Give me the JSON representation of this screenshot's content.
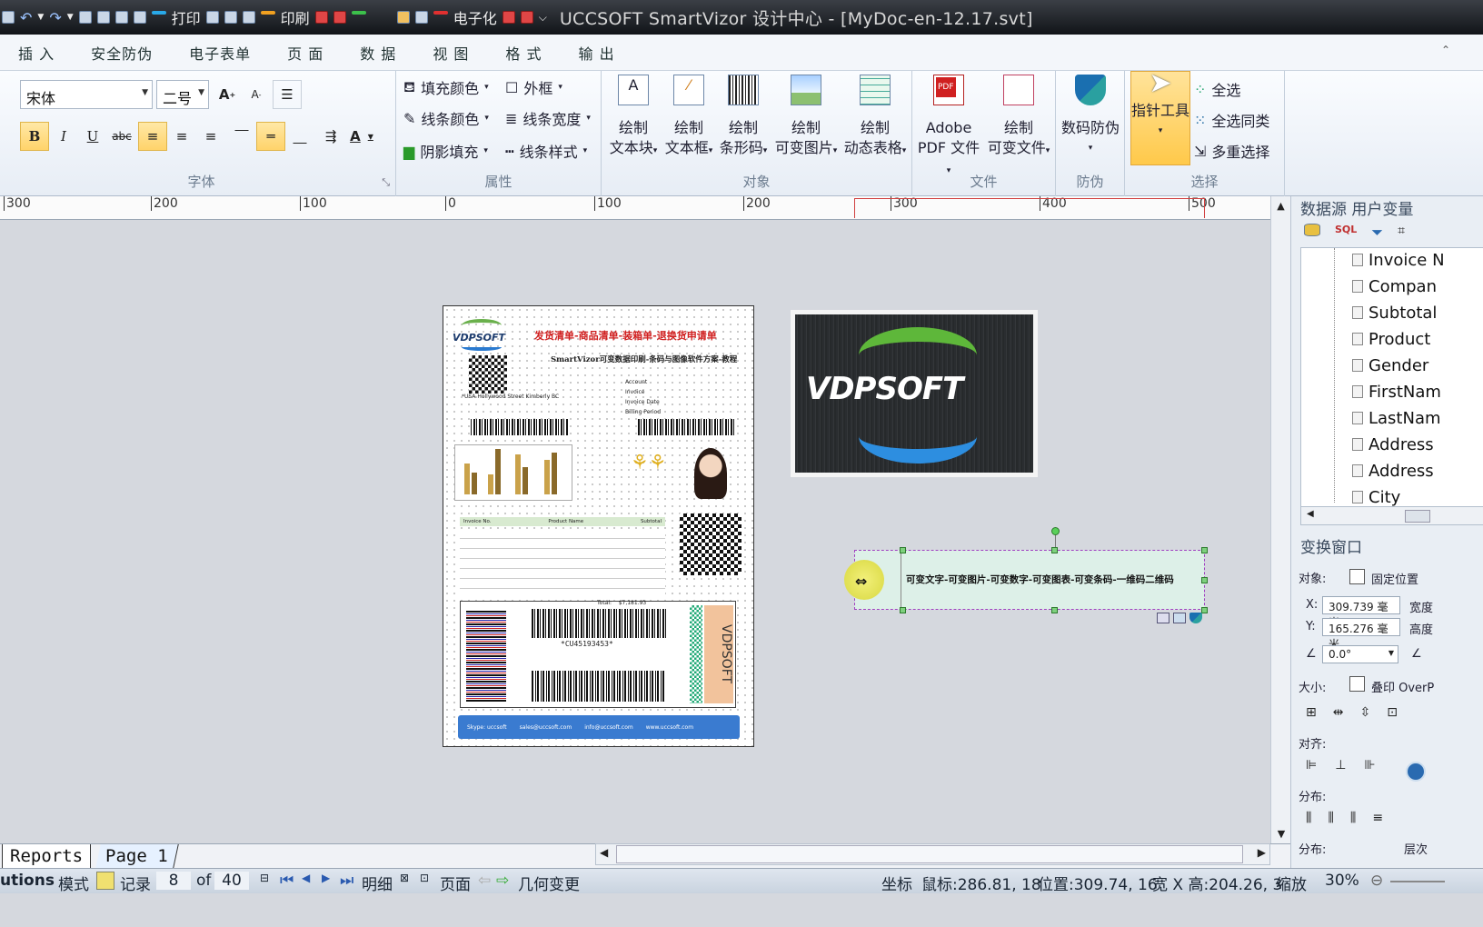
{
  "titlebar": {
    "quick": [
      "打印",
      "印刷",
      "电子化"
    ],
    "title": "UCCSOFT SmartVizor 设计中心 - [MyDoc-en-12.17.svt]"
  },
  "menu": [
    "插 入",
    "安全防伪",
    "电子表单",
    "页 面",
    "数 据",
    "视 图",
    "格 式",
    "输 出"
  ],
  "ribbon": {
    "font": {
      "name": "宋体",
      "size": "二号",
      "group_label": "字体",
      "bold": "B",
      "italic": "I",
      "underline": "U",
      "strike": "abc",
      "grow": "A",
      "shrink": "A",
      "color": "A"
    },
    "attr": {
      "fill": "填充颜色",
      "line_color": "线条颜色",
      "shadow": "阴影填充",
      "frame": "外框",
      "line_width": "线条宽度",
      "line_style": "线条样式",
      "group_label": "属性"
    },
    "object": {
      "items": [
        {
          "l1": "绘制",
          "l2": "文本块"
        },
        {
          "l1": "绘制",
          "l2": "文本框"
        },
        {
          "l1": "绘制",
          "l2": "条形码"
        },
        {
          "l1": "绘制",
          "l2": "可变图片"
        },
        {
          "l1": "绘制",
          "l2": "动态表格"
        }
      ],
      "group_label": "对象"
    },
    "file": {
      "items": [
        {
          "l1": "Adobe",
          "l2": "PDF 文件"
        },
        {
          "l1": "绘制",
          "l2": "可变文件"
        }
      ],
      "group_label": "文件"
    },
    "protect": {
      "label": "数码防伪",
      "group_label": "防伪"
    },
    "select": {
      "pointer": "指针工具",
      "all": "全选",
      "same": "全选同类",
      "multi": "多重选择",
      "group_label": "选择"
    }
  },
  "ruler": [
    "300",
    "200",
    "100",
    "0",
    "100",
    "200",
    "300",
    "400",
    "500"
  ],
  "document": {
    "heading": "发货清单-商品清单-装箱单-退换货申请单",
    "subheading": "SmartVizor可变数据印刷-条码与图像软件方案-教程",
    "logo_small": "VDPSOFT",
    "account_labels": [
      "Account",
      "Invoice",
      "Invoice Date",
      "Billing Period"
    ],
    "address": "*USA Hollywood Street Kimberly BC",
    "table_headers": [
      "Invoice No.",
      "Product Name",
      "Subtotal"
    ],
    "total_label": "Total:",
    "total_value": "$7,181.93",
    "barcode_text": "*CU45193453*",
    "side_brand": "VDPSOFT",
    "footer": [
      "Skype: uccsoft",
      "sales@uccsoft.com",
      "info@uccsoft.com",
      "www.uccsoft.com"
    ]
  },
  "logo_image_text": "VDPSOFT",
  "variable_text": "可变文字-可变图片-可变数字-可变图表-可变条码-一维码二维码",
  "panel": {
    "datasource_title": "数据源 用户变量",
    "fields": [
      "Invoice N",
      "Compan",
      "Subtotal",
      "Product",
      "Gender",
      "FirstNam",
      "LastNam",
      "Address",
      "Address",
      "City"
    ],
    "transform_title": "变换窗口",
    "object_label": "对象:",
    "fixed_label": "固定位置",
    "x_label": "X:",
    "x_value": "309.739 毫米",
    "y_label": "Y:",
    "y_value": "165.276 毫米",
    "width_label": "宽度",
    "height_label": "高度",
    "angle_value": "0.0°",
    "size_label": "大小:",
    "overprint_label": "叠印 OverP",
    "align_label": "对齐:",
    "dist_label": "分布:",
    "dist_label2": "分布:",
    "layer_label": "层次"
  },
  "tabs": [
    "Reports",
    "Page   1"
  ],
  "status": {
    "solutions": "utions",
    "mode": "模式",
    "record": "记录",
    "current": "8",
    "of": "of",
    "total": "40",
    "detail": "明细",
    "page": "页面",
    "geo": "几何变更",
    "coord": "坐标",
    "mouse": "鼠标:286.81, 18",
    "pos": "位置:309.74, 16",
    "size": "宽 X 高:204.26, 3",
    "zoom_label": "缩放",
    "zoom": "30%"
  }
}
